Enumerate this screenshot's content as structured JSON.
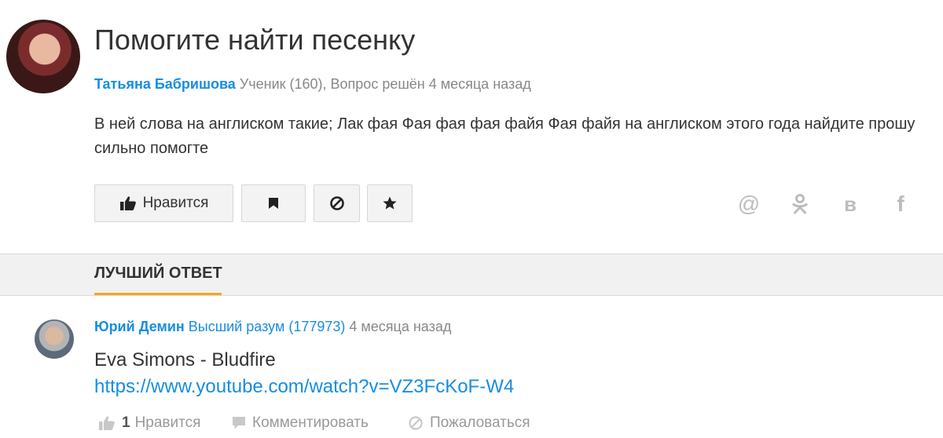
{
  "question": {
    "title": "Помогите найти песенку",
    "author": "Татьяна Бабришова",
    "meta": "Ученик (160), Вопрос решён 4 месяца назад",
    "body": "В ней слова на англиском такие; Лак фая Фая фая фая файя Фая файя на англиском этого года найдите прошу сильно помогте",
    "like_label": "Нравится"
  },
  "share": {
    "mail_glyph": "@",
    "vk_glyph": "в",
    "fb_glyph": "f"
  },
  "best_answer": {
    "header": "ЛУЧШИЙ ОТВЕТ",
    "author": "Юрий Демин",
    "rank": "Высший разум (177973)",
    "time": "4 месяца назад",
    "text": "Eva Simons - Bludfire",
    "link": "https://www.youtube.com/watch?v=VZ3FcKoF-W4",
    "likes_count": "1",
    "like_label": "Нравится",
    "comment_label": "Комментировать",
    "report_label": "Пожаловаться"
  },
  "colors": {
    "accent": "#168de2",
    "tab_underline": "#f5a623",
    "band_bg": "#f1f1f1"
  }
}
